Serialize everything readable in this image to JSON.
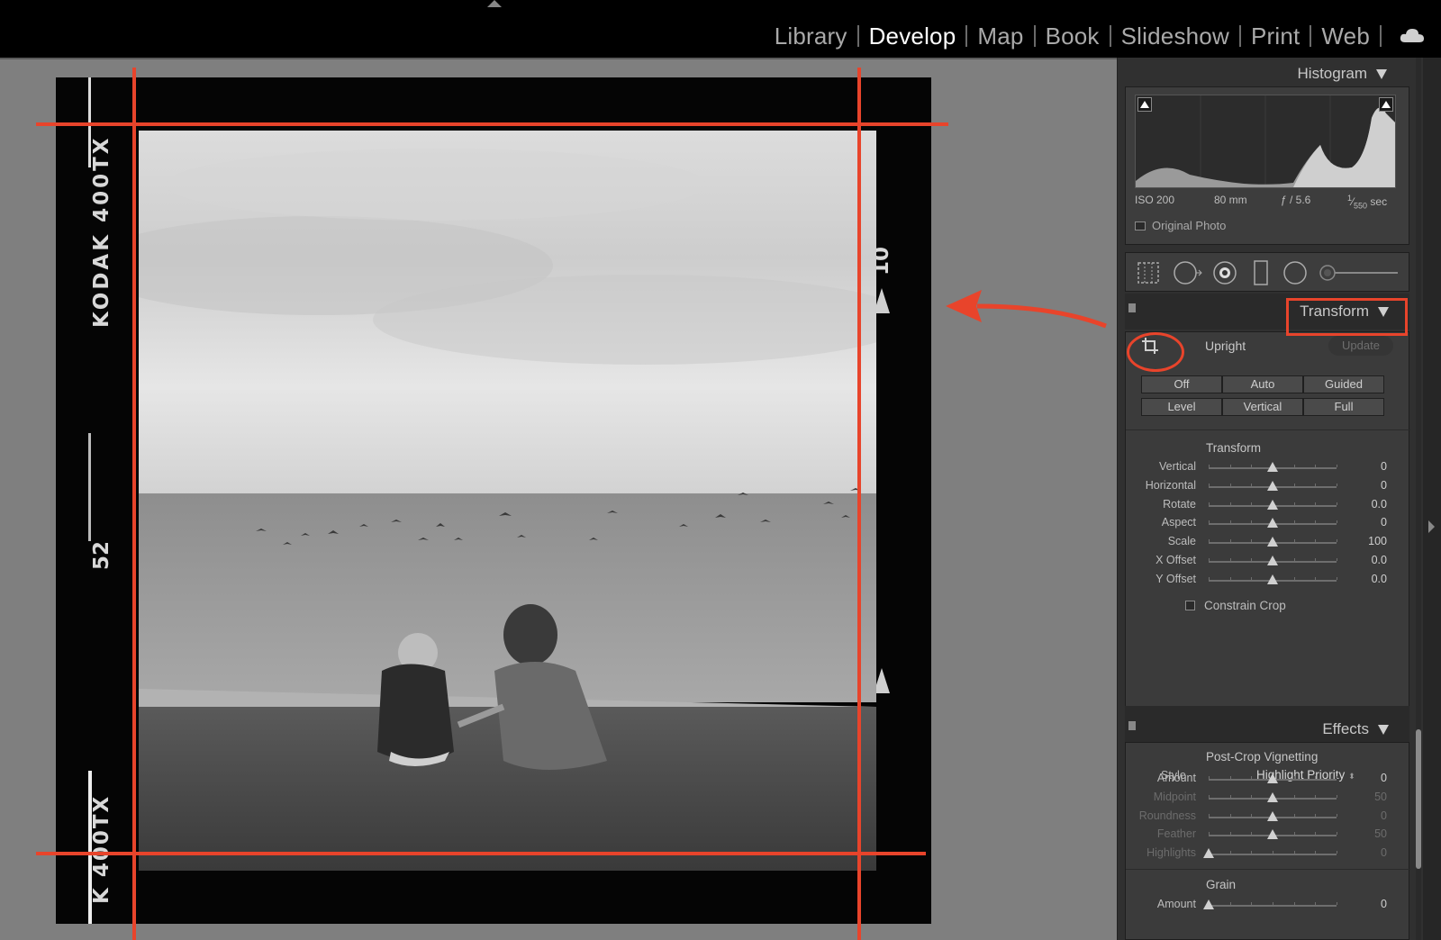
{
  "modules": [
    "Library",
    "Develop",
    "Map",
    "Book",
    "Slideshow",
    "Print",
    "Web"
  ],
  "active_module": "Develop",
  "film_edge": {
    "left_top": "KODAK 400TX",
    "left_mid": "52",
    "left_bottom": "K 400TX",
    "right_top": "10"
  },
  "histogram": {
    "title": "Histogram",
    "iso": "ISO 200",
    "focal": "80 mm",
    "aperture": "ƒ / 5.6",
    "shutter_num": "1",
    "shutter_den": "550",
    "shutter_unit": "sec",
    "original_photo": "Original Photo"
  },
  "transform_panel": {
    "title": "Transform",
    "upright_label": "Upright",
    "update_label": "Update",
    "upright_buttons_row1": [
      "Off",
      "Auto",
      "Guided"
    ],
    "upright_buttons_row2": [
      "Level",
      "Vertical",
      "Full"
    ],
    "section_label": "Transform",
    "sliders": [
      {
        "label": "Vertical",
        "value": "0",
        "pos": 0.5
      },
      {
        "label": "Horizontal",
        "value": "0",
        "pos": 0.5
      },
      {
        "label": "Rotate",
        "value": "0.0",
        "pos": 0.5
      },
      {
        "label": "Aspect",
        "value": "0",
        "pos": 0.5
      },
      {
        "label": "Scale",
        "value": "100",
        "pos": 0.5
      },
      {
        "label": "X Offset",
        "value": "0.0",
        "pos": 0.5
      },
      {
        "label": "Y Offset",
        "value": "0.0",
        "pos": 0.5
      }
    ],
    "constrain_crop": "Constrain Crop"
  },
  "effects_panel": {
    "title": "Effects",
    "vignette_title": "Post-Crop Vignetting",
    "style_label": "Style",
    "style_value": "Highlight Priority",
    "vignette_sliders": [
      {
        "label": "Amount",
        "value": "0",
        "pos": 0.5,
        "dim": false
      },
      {
        "label": "Midpoint",
        "value": "50",
        "pos": 0.5,
        "dim": true
      },
      {
        "label": "Roundness",
        "value": "0",
        "pos": 0.5,
        "dim": true
      },
      {
        "label": "Feather",
        "value": "50",
        "pos": 0.5,
        "dim": true
      },
      {
        "label": "Highlights",
        "value": "0",
        "pos": 0.0,
        "dim": true
      }
    ],
    "grain_title": "Grain",
    "grain_sliders": [
      {
        "label": "Amount",
        "value": "0",
        "pos": 0.0,
        "dim": false
      }
    ]
  },
  "colors": {
    "annotation_red": "#e8442b",
    "canvas_gray": "#7f7f7f",
    "panel_bg": "#3b3b3b"
  }
}
